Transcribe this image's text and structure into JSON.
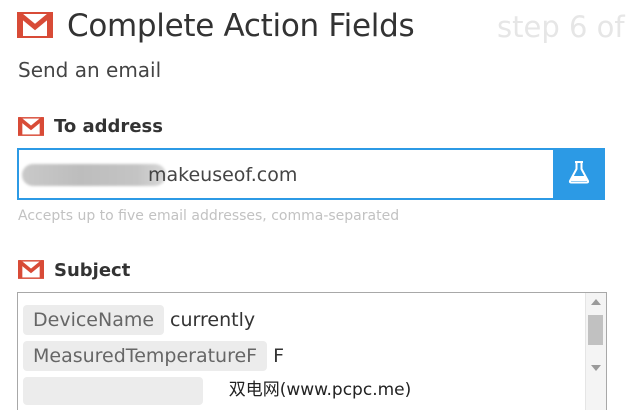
{
  "header": {
    "title": "Complete Action Fields",
    "step": "step 6 of",
    "subtitle": "Send an email"
  },
  "fields": {
    "to": {
      "label": "To address",
      "value": "makeuseof.com",
      "hint": "Accepts up to five email addresses, comma-separated",
      "test_icon": "flask-icon"
    },
    "subject": {
      "label": "Subject",
      "rows": [
        {
          "ingredient": "DeviceName",
          "text": "currently"
        },
        {
          "ingredient": "MeasuredTemperatureF",
          "text": "F"
        }
      ]
    }
  },
  "icons": {
    "service": "gmail-icon",
    "gmail_red": "#d84b37",
    "accent": "#2c9ae5"
  },
  "watermark": "双电网(www.pcpc.me)"
}
